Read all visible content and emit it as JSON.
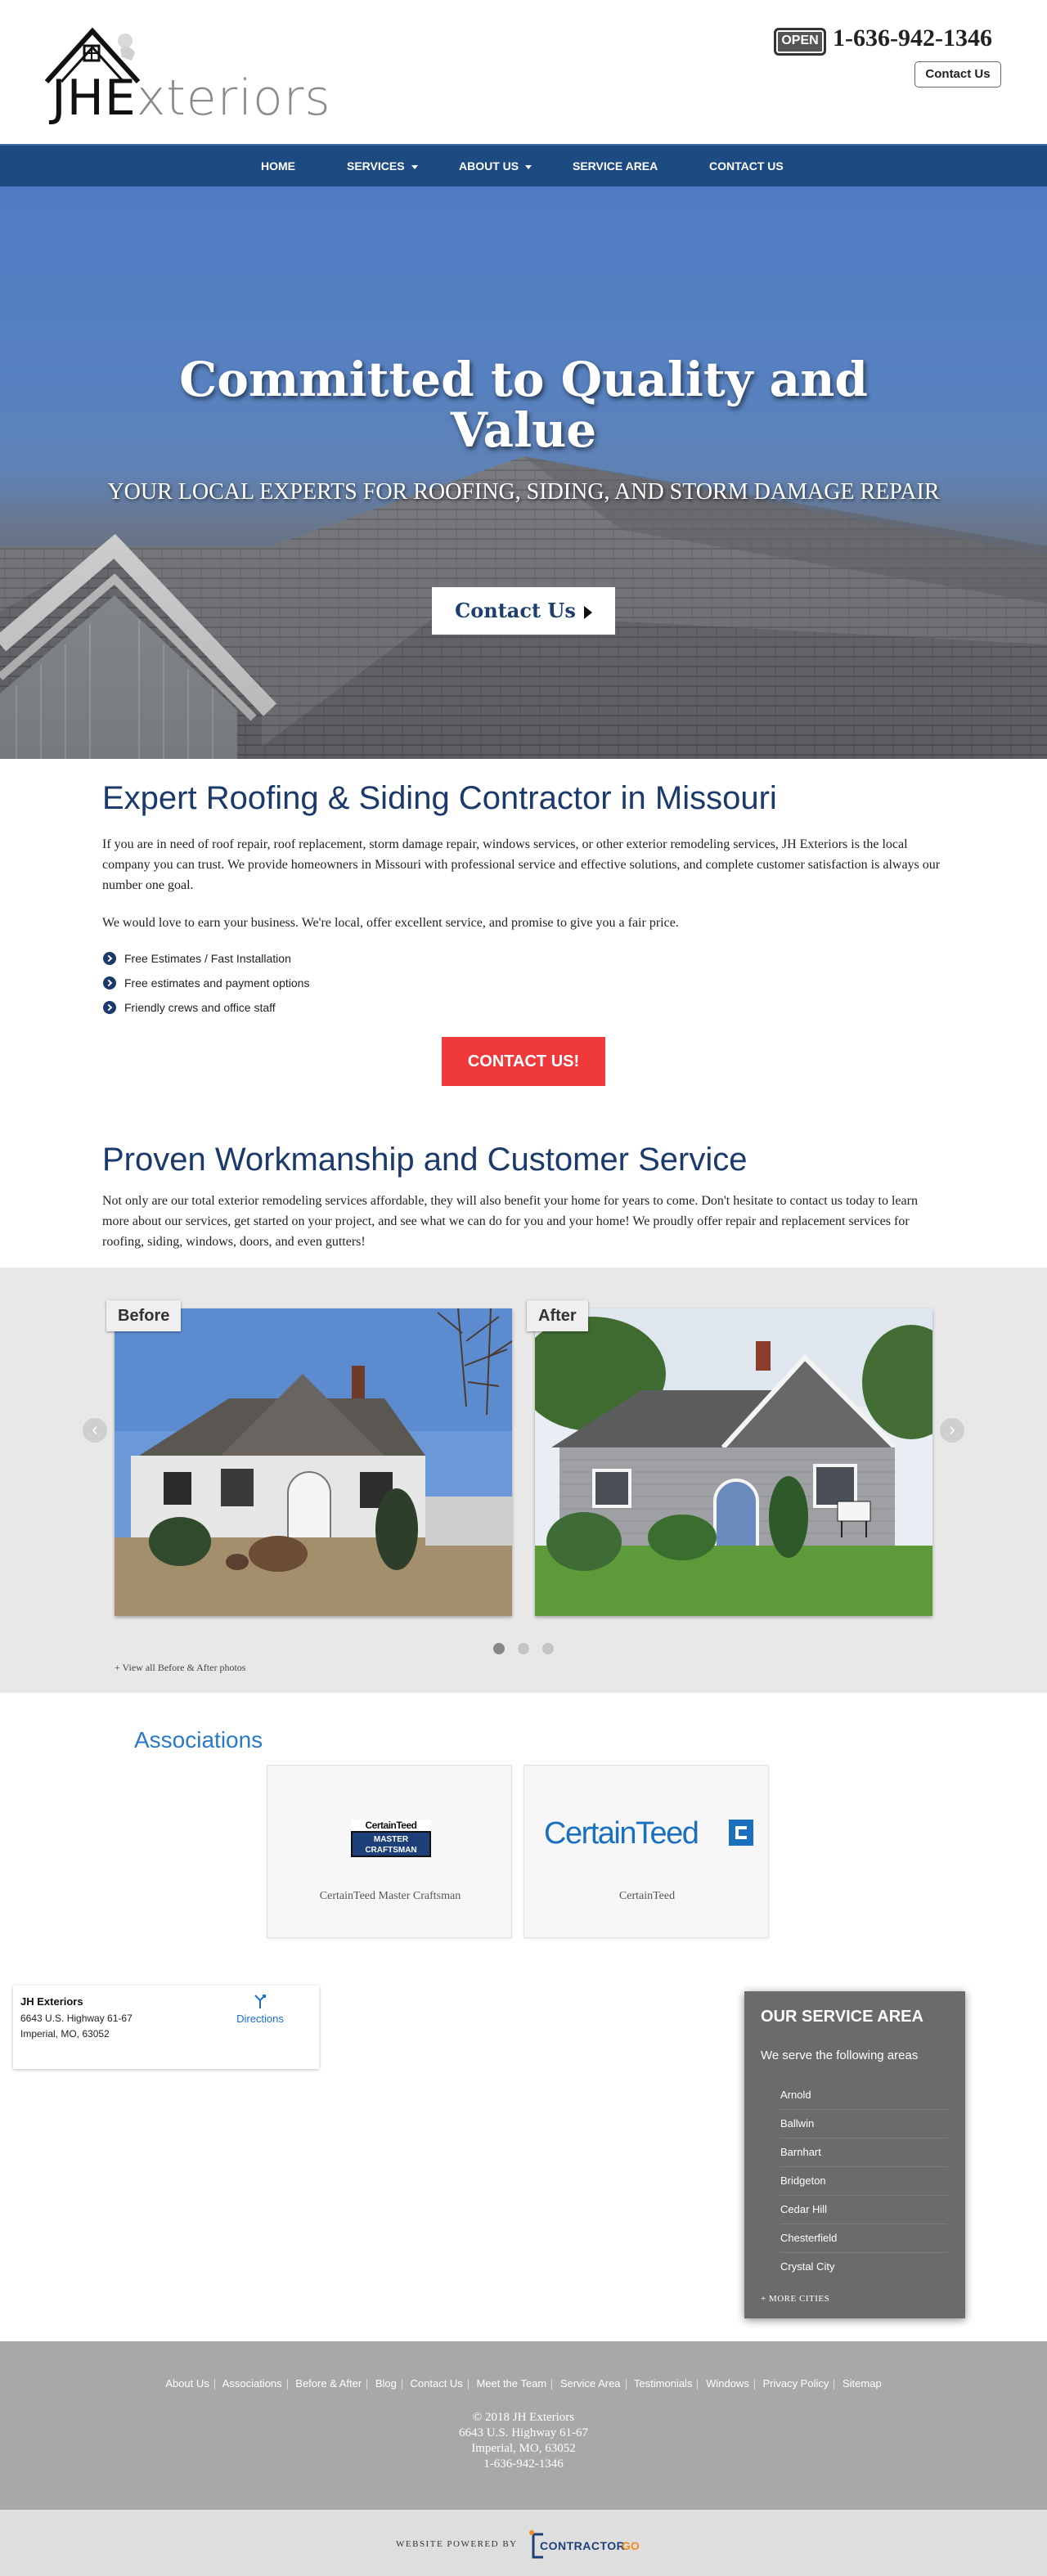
{
  "header": {
    "logo_text_bold": "JHE",
    "logo_text_light": "xteriors",
    "open_sign": "OPEN",
    "phone": "1-636-942-1346",
    "contact_button": "Contact Us"
  },
  "nav": {
    "items": [
      {
        "label": "HOME",
        "dropdown": false
      },
      {
        "label": "SERVICES",
        "dropdown": true
      },
      {
        "label": "ABOUT US",
        "dropdown": true
      },
      {
        "label": "SERVICE AREA",
        "dropdown": false
      },
      {
        "label": "CONTACT US",
        "dropdown": false
      }
    ]
  },
  "hero": {
    "title": "Committed to Quality and Value",
    "subtitle": "YOUR LOCAL EXPERTS FOR ROOFING, SIDING, AND STORM DAMAGE REPAIR",
    "button": "Contact Us"
  },
  "intro": {
    "heading": "Expert Roofing & Siding Contractor in Missouri",
    "paragraph1": "If you are in need of roof repair, roof replacement, storm damage repair, windows services, or other exterior remodeling services, JH Exteriors is the local company you can trust. We provide homeowners in Missouri with professional service and effective solutions, and complete customer satisfaction is always our number one goal.",
    "paragraph2": "We would love to earn your business. We're local, offer excellent service, and promise to give you a fair price.",
    "bullets": [
      "Free Estimates / Fast Installation",
      "Free estimates and payment options",
      "Friendly crews and office staff"
    ],
    "cta": "CONTACT US!"
  },
  "workmanship": {
    "heading": "Proven Workmanship and Customer Service",
    "paragraph": "Not only are our total exterior remodeling services affordable, they will also benefit your home for years to come. Don't hesitate to contact us today to learn more about our services, get started on your project, and see what we can do for you and your home! We proudly offer repair and replacement services for roofing, siding, windows, doors, and even gutters!"
  },
  "gallery": {
    "before_label": "Before",
    "after_label": "After",
    "prev_icon": "‹",
    "next_icon": "›",
    "slides": 3,
    "active_slide": 1,
    "view_all": "+  View all Before & After photos"
  },
  "associations": {
    "title": "Associations",
    "items": [
      {
        "caption": "CertainTeed Master Craftsman",
        "logo_top": "CertainTeed",
        "logo_bottom1": "MASTER",
        "logo_bottom2": "CRAFTSMAN"
      },
      {
        "caption": "CertainTeed",
        "logo_text": "CertainTeed"
      }
    ]
  },
  "location": {
    "name": "JH Exteriors",
    "address1": "6643 U.S. Highway 61-67",
    "address2": "Imperial, MO, 63052",
    "directions": "Directions"
  },
  "service_area": {
    "title": "OUR SERVICE AREA",
    "subtitle": "We serve the following areas",
    "cities": [
      "Arnold",
      "Ballwin",
      "Barnhart",
      "Bridgeton",
      "Cedar Hill",
      "Chesterfield",
      "Crystal City"
    ],
    "more": "+ MORE CITIES"
  },
  "footer": {
    "links": [
      "About Us",
      "Associations",
      "Before & After",
      "Blog",
      "Contact Us",
      "Meet the Team",
      "Service Area",
      "Testimonials",
      "Windows",
      "Privacy Policy",
      "Sitemap"
    ],
    "copyright": "© 2018 JH Exteriors",
    "address1": "6643 U.S. Highway 61-67",
    "address2": "Imperial, MO, 63052",
    "phone": "1-636-942-1346",
    "powered_by": "WEBSITE POWERED BY",
    "powered_logo_a": "CONTRACTOR",
    "powered_logo_b": "GO"
  },
  "colors": {
    "nav_bg": "#1d4a80",
    "heading_blue": "#1b3a6b",
    "cta_red": "#f0393a",
    "assoc_blue": "#2a78c8",
    "service_box_bg": "#6b6b6b",
    "footer_bg": "#a8a8a8"
  }
}
